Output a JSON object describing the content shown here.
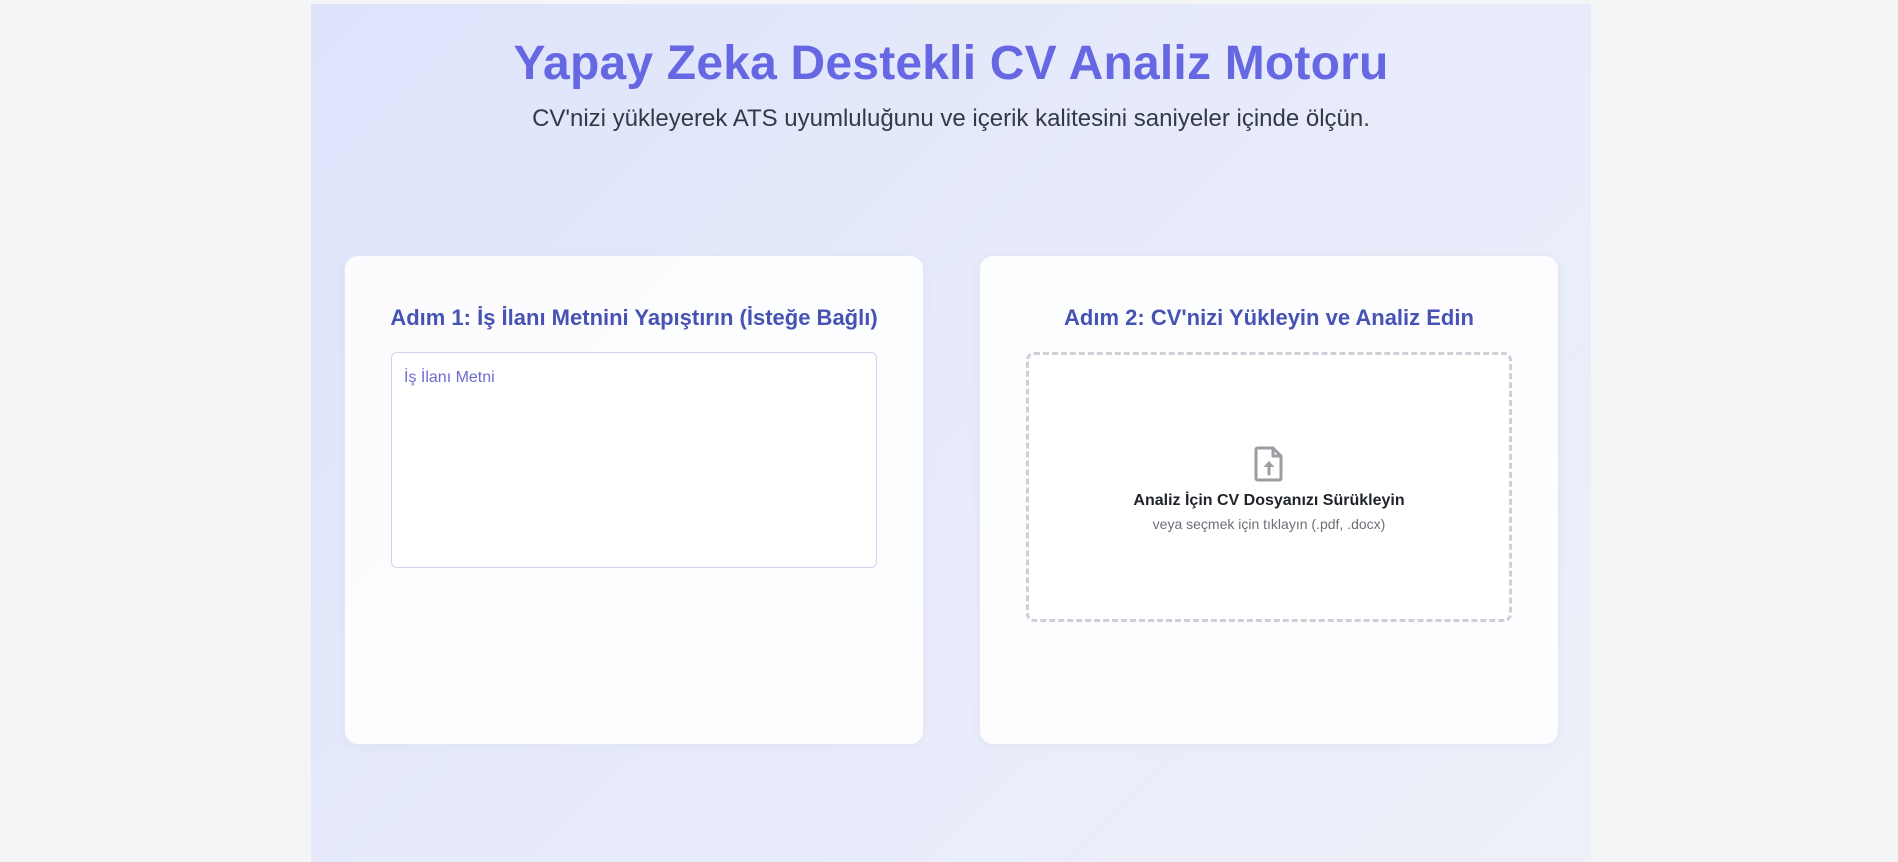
{
  "header": {
    "title": "Yapay Zeka Destekli CV Analiz Motoru",
    "subtitle": "CV'nizi yükleyerek ATS uyumluluğunu ve içerik kalitesini saniyeler içinde ölçün."
  },
  "step1": {
    "title": "Adım 1: İş İlanı Metnini Yapıştırın (İsteğe Bağlı)",
    "textarea_value": "",
    "textarea_placeholder": "İş İlanı Metni"
  },
  "step2": {
    "title": "Adım 2: CV'nizi Yükleyin ve Analiz Edin",
    "drop_main": "Analiz İçin CV Dosyanızı Sürükleyin",
    "drop_sub": "veya seçmek için tıklayın (.pdf, .docx)",
    "icon": "file-upload-icon"
  },
  "colors": {
    "title": "#6667e2",
    "card_title": "#4653b3",
    "placeholder": "#6d6bd0",
    "dropzone_border": "#cdd0d6"
  }
}
